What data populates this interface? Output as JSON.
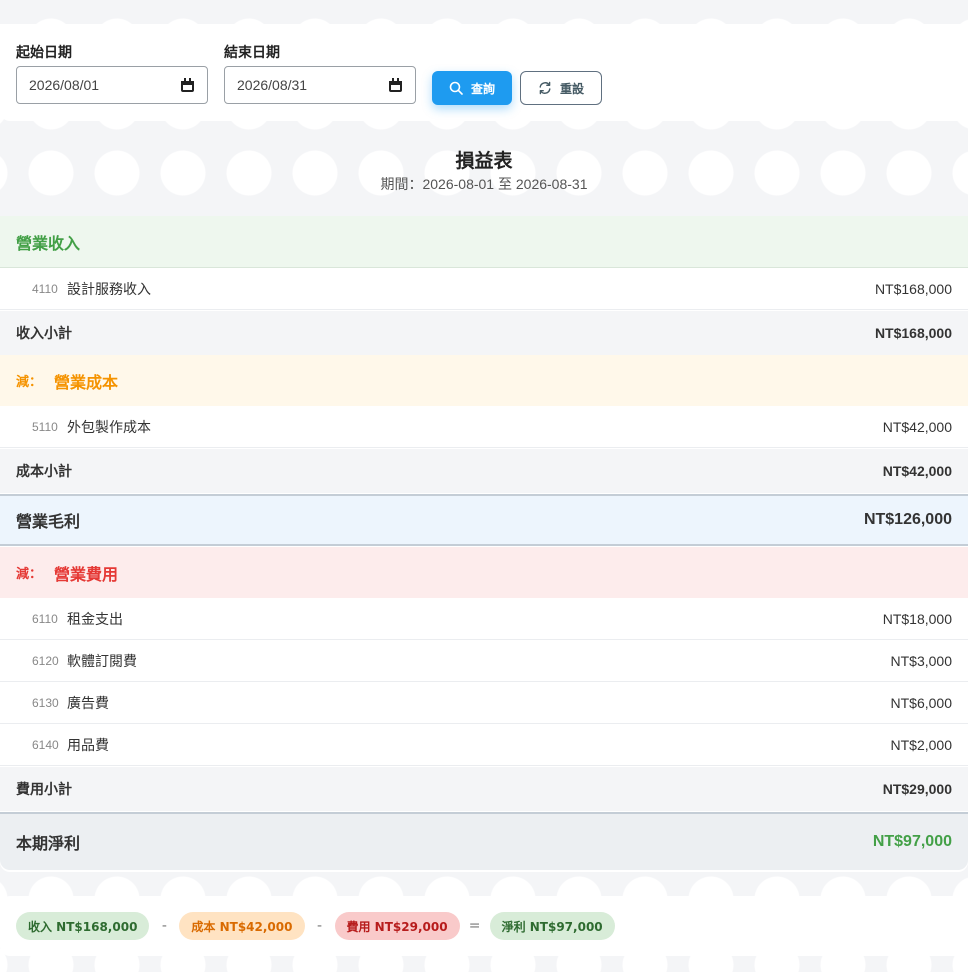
{
  "filter": {
    "start_label": "起始日期",
    "start_value": "2026/08/01",
    "end_label": "結束日期",
    "end_value": "2026/08/31",
    "search_label": "查詢",
    "reset_label": "重設"
  },
  "report": {
    "title": "損益表",
    "period": "期間：2026-08-01 至 2026-08-31"
  },
  "income": {
    "heading": "營業收入",
    "items": [
      {
        "code": "4110",
        "name": "設計服務收入",
        "amount": "NT$168,000"
      }
    ],
    "subtotal_label": "收入小計",
    "subtotal": "NT$168,000"
  },
  "cost": {
    "less": "減：",
    "heading": "營業成本",
    "items": [
      {
        "code": "5110",
        "name": "外包製作成本",
        "amount": "NT$42,000"
      }
    ],
    "subtotal_label": "成本小計",
    "subtotal": "NT$42,000"
  },
  "gross": {
    "label": "營業毛利",
    "amount": "NT$126,000"
  },
  "expense": {
    "less": "減：",
    "heading": "營業費用",
    "items": [
      {
        "code": "6110",
        "name": "租金支出",
        "amount": "NT$18,000"
      },
      {
        "code": "6120",
        "name": "軟體訂閱費",
        "amount": "NT$3,000"
      },
      {
        "code": "6130",
        "name": "廣告費",
        "amount": "NT$6,000"
      },
      {
        "code": "6140",
        "name": "用品費",
        "amount": "NT$2,000"
      }
    ],
    "subtotal_label": "費用小計",
    "subtotal": "NT$29,000"
  },
  "net": {
    "label": "本期淨利",
    "amount": "NT$97,000"
  },
  "summary": {
    "income": "收入 NT$168,000",
    "cost": "成本 NT$42,000",
    "expense": "費用 NT$29,000",
    "net": "淨利 NT$97,000",
    "minus": "-",
    "equals": "="
  },
  "colors": {
    "primary": "#1e9bf0",
    "income": "#43a047",
    "cost": "#f59300",
    "expense": "#e53935"
  }
}
